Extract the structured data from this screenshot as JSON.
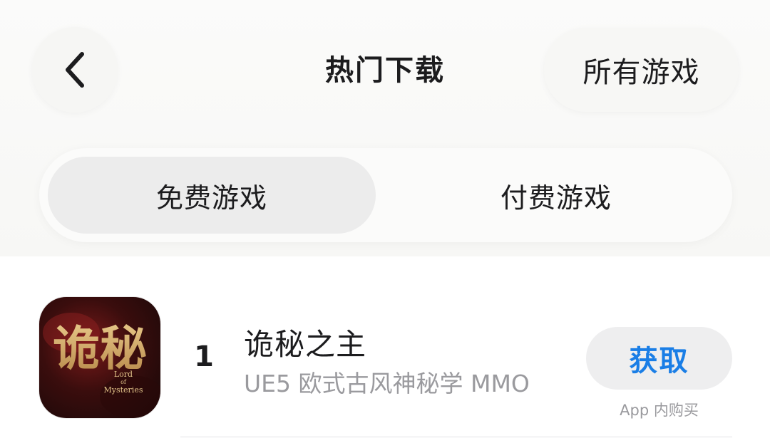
{
  "header": {
    "title": "热门下载",
    "all_games_label": "所有游戏",
    "back_icon": "chevron-left-icon"
  },
  "segments": [
    {
      "label": "免费游戏",
      "selected": true
    },
    {
      "label": "付费游戏",
      "selected": false
    }
  ],
  "apps": [
    {
      "rank": "1",
      "name": "诡秘之主",
      "subtitle": "UE5 欧式古风神秘学 MMO",
      "action_label": "获取",
      "purchase_note": "App 内购买",
      "icon": {
        "title_text": "诡秘",
        "logo_text_line1": "Lord",
        "logo_text_line2": "of",
        "logo_text_line3": "Mysteries"
      }
    }
  ],
  "colors": {
    "accent": "#1a7ee6",
    "secondary_text": "#9a9a9e",
    "selected_segment": "#ececec"
  }
}
